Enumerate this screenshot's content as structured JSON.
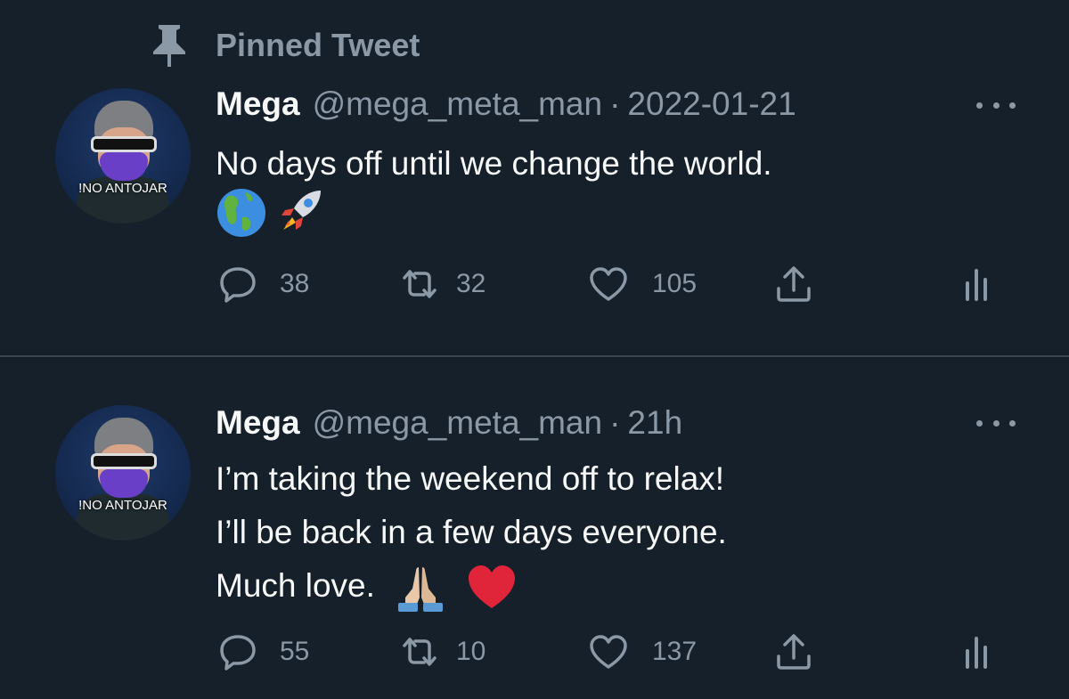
{
  "pinned_label": "Pinned Tweet",
  "avatar_text": "!NO ANTOJAR",
  "tweets": [
    {
      "name": "Mega",
      "handle": "@mega_meta_man",
      "separator": "·",
      "time": "2022-01-21",
      "lines": [
        "No days off until we change the world."
      ],
      "emojis": [
        "globe-americas",
        "rocket"
      ],
      "replies": "38",
      "retweets": "32",
      "likes": "105"
    },
    {
      "name": "Mega",
      "handle": "@mega_meta_man",
      "separator": "·",
      "time": "21h",
      "lines": [
        "I’m taking the weekend off to relax!",
        "I’ll be back in a few days everyone.",
        "Much love."
      ],
      "emojis": [
        "folded-hands",
        "red-heart"
      ],
      "replies": "55",
      "retweets": "10",
      "likes": "137"
    }
  ],
  "colors": {
    "background": "#15202b",
    "text": "#f7f9f9",
    "secondary": "#8b98a5",
    "divider": "#38444d"
  }
}
